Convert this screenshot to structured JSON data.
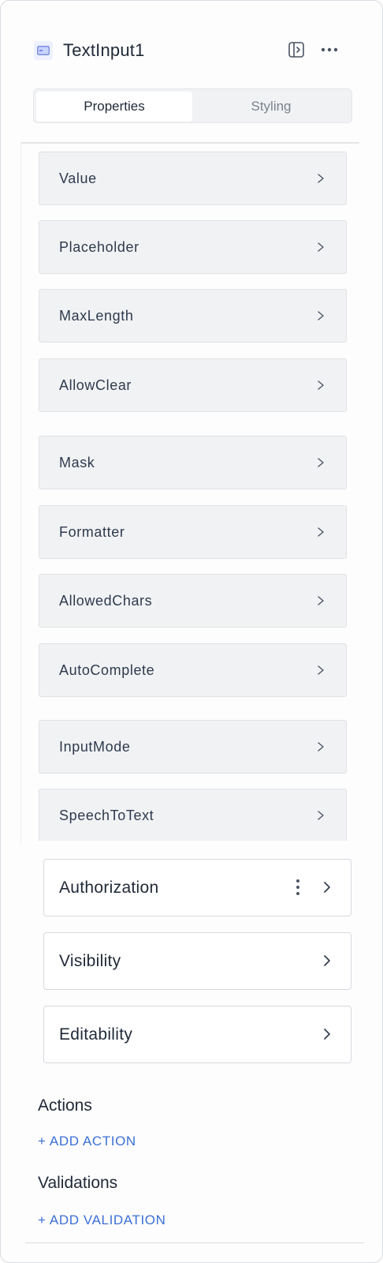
{
  "header": {
    "component_name": "TextInput1",
    "icons": [
      "text-input-component-icon",
      "dock-panel-icon",
      "more-horizontal-icon"
    ]
  },
  "tabs": [
    {
      "label": "Properties",
      "active": true
    },
    {
      "label": "Styling",
      "active": false
    }
  ],
  "properties": [
    {
      "label": "Value"
    },
    {
      "label": "Placeholder"
    },
    {
      "label": "MaxLength"
    },
    {
      "label": "AllowClear"
    },
    {
      "label": "Mask"
    },
    {
      "label": "Formatter"
    },
    {
      "label": "AllowedChars"
    },
    {
      "label": "AutoComplete"
    },
    {
      "label": "InputMode"
    },
    {
      "label": "SpeechToText"
    }
  ],
  "cards": [
    {
      "label": "Authorization",
      "has_menu": true
    },
    {
      "label": "Visibility",
      "has_menu": false
    },
    {
      "label": "Editability",
      "has_menu": false
    }
  ],
  "actions": {
    "title": "Actions",
    "add_label": "+ ADD ACTION"
  },
  "validations": {
    "title": "Validations",
    "add_label": "+ ADD VALIDATION"
  },
  "colors": {
    "link": "#3b6fd6",
    "text": "#1f2937",
    "row_bg": "#f1f2f4",
    "border": "#d9dce1"
  }
}
